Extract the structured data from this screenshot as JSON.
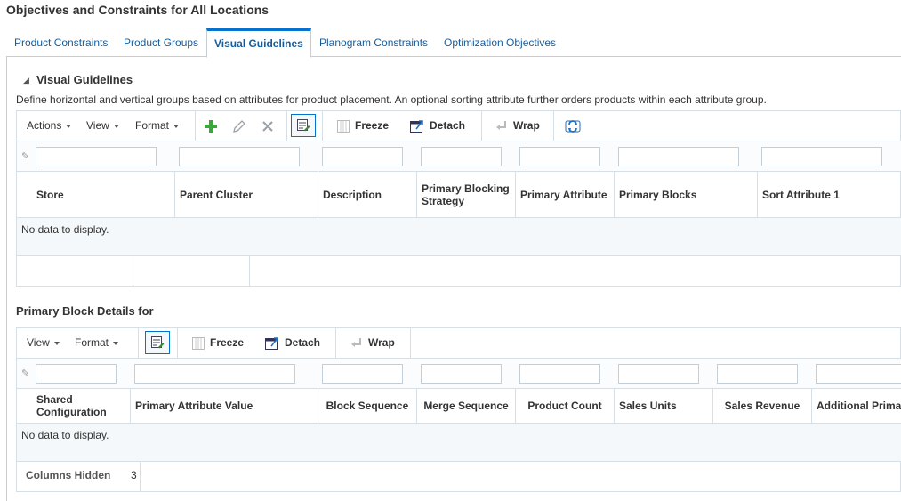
{
  "page": {
    "title": "Objectives and Constraints for All Locations"
  },
  "tabs": [
    {
      "label": "Product Constraints",
      "active": false
    },
    {
      "label": "Product Groups",
      "active": false
    },
    {
      "label": "Visual Guidelines",
      "active": true
    },
    {
      "label": "Planogram Constraints",
      "active": false
    },
    {
      "label": "Optimization Objectives",
      "active": false
    }
  ],
  "section": {
    "title": "Visual Guidelines",
    "description": "Define horizontal and vertical groups based on attributes for product placement. An optional sorting attribute further orders products within each attribute group."
  },
  "toolbar1": {
    "actions": "Actions",
    "view": "View",
    "format": "Format",
    "freeze": "Freeze",
    "detach": "Detach",
    "wrap": "Wrap"
  },
  "table1": {
    "columns": [
      "Store",
      "Parent Cluster",
      "Description",
      "Primary Blocking Strategy",
      "Primary Attribute",
      "Primary Blocks",
      "Sort Attribute 1"
    ],
    "empty_text": "No data to display."
  },
  "subsection": {
    "title": "Primary Block Details for"
  },
  "toolbar2": {
    "view": "View",
    "format": "Format",
    "freeze": "Freeze",
    "detach": "Detach",
    "wrap": "Wrap"
  },
  "table2": {
    "columns": [
      "Shared Configuration",
      "Primary Attribute Value",
      "Block Sequence",
      "Merge Sequence",
      "Product Count",
      "Sales Units",
      "Sales Revenue",
      "Additional Prima"
    ],
    "empty_text": "No data to display.",
    "columns_hidden_label": "Columns Hidden",
    "columns_hidden_count": "3"
  },
  "colors": {
    "link": "#145c9e",
    "accent": "#0572ce",
    "border": "#d6dfe6"
  },
  "icons": [
    "add-icon",
    "edit-icon",
    "delete-icon",
    "query-by-example-icon",
    "freeze-icon",
    "detach-icon",
    "wrap-icon",
    "refresh-icon",
    "pencil-icon",
    "disclosure-triangle-icon"
  ]
}
